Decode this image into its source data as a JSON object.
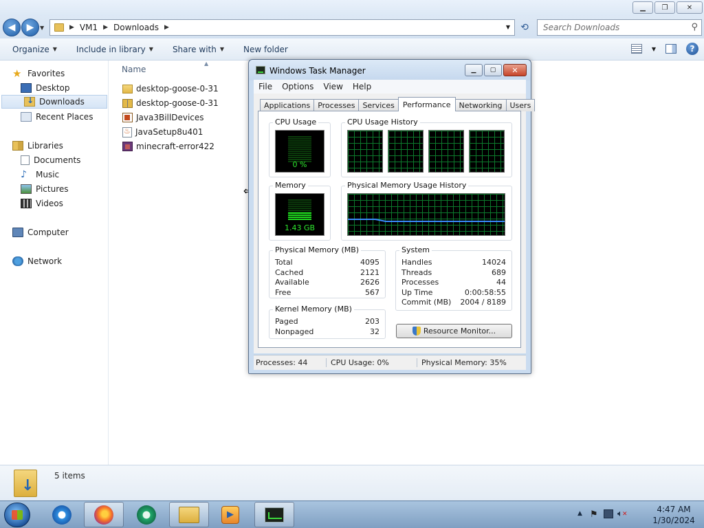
{
  "explorer": {
    "address": {
      "crumbs": [
        "VM1",
        "Downloads"
      ]
    },
    "search": {
      "placeholder": "Search Downloads"
    },
    "toolbar": {
      "organize": "Organize",
      "include_in_library": "Include in library",
      "share_with": "Share with",
      "new_folder": "New folder"
    },
    "nav": {
      "favorites": "Favorites",
      "desktop": "Desktop",
      "downloads": "Downloads",
      "recent_places": "Recent Places",
      "libraries": "Libraries",
      "documents": "Documents",
      "music": "Music",
      "pictures": "Pictures",
      "videos": "Videos",
      "computer": "Computer",
      "network": "Network"
    },
    "filelist": {
      "column_name": "Name",
      "files": [
        {
          "name": "desktop-goose-0-31",
          "icon": "folder-icon"
        },
        {
          "name": "desktop-goose-0-31",
          "icon": "zip-folder-icon"
        },
        {
          "name": "Java3BillDevices",
          "icon": "jar-icon"
        },
        {
          "name": "JavaSetup8u401",
          "icon": "java-installer-icon"
        },
        {
          "name": "minecraft-error422",
          "icon": "minecraft-icon"
        }
      ]
    },
    "status": {
      "items_count": "5 items"
    }
  },
  "taskmanager": {
    "title": "Windows Task Manager",
    "menu": [
      "File",
      "Options",
      "View",
      "Help"
    ],
    "tabs": [
      "Applications",
      "Processes",
      "Services",
      "Performance",
      "Networking",
      "Users"
    ],
    "active_tab": "Performance",
    "cpu_usage": {
      "label": "CPU Usage",
      "value": "0 %",
      "fraction": 0.0
    },
    "cpu_history": {
      "label": "CPU Usage History"
    },
    "memory": {
      "label": "Memory",
      "value": "1.43 GB",
      "fraction": 0.35
    },
    "mem_history": {
      "label": "Physical Memory Usage History"
    },
    "physical_memory": {
      "label": "Physical Memory (MB)",
      "rows": [
        {
          "k": "Total",
          "v": "4095"
        },
        {
          "k": "Cached",
          "v": "2121"
        },
        {
          "k": "Available",
          "v": "2626"
        },
        {
          "k": "Free",
          "v": "567"
        }
      ]
    },
    "kernel_memory": {
      "label": "Kernel Memory (MB)",
      "rows": [
        {
          "k": "Paged",
          "v": "203"
        },
        {
          "k": "Nonpaged",
          "v": "32"
        }
      ]
    },
    "system": {
      "label": "System",
      "rows": [
        {
          "k": "Handles",
          "v": "14024"
        },
        {
          "k": "Threads",
          "v": "689"
        },
        {
          "k": "Processes",
          "v": "44"
        },
        {
          "k": "Up Time",
          "v": "0:00:58:55"
        },
        {
          "k": "Commit (MB)",
          "v": "2004 / 8189"
        }
      ]
    },
    "resource_monitor_button": "Resource Monitor...",
    "status": {
      "processes": "Processes: 44",
      "cpu": "CPU Usage: 0%",
      "memory": "Physical Memory: 35%"
    }
  },
  "taskbar": {
    "pinned": [
      "internet-explorer",
      "firefox",
      "chat-app",
      "windows-explorer",
      "media-player",
      "task-manager"
    ],
    "clock": {
      "time": "4:47 AM",
      "date": "1/30/2024"
    }
  },
  "colors": {
    "graph_green": "#2ee82e",
    "grid_green": "#0c7a2c",
    "accent_blue": "#2466b4"
  }
}
